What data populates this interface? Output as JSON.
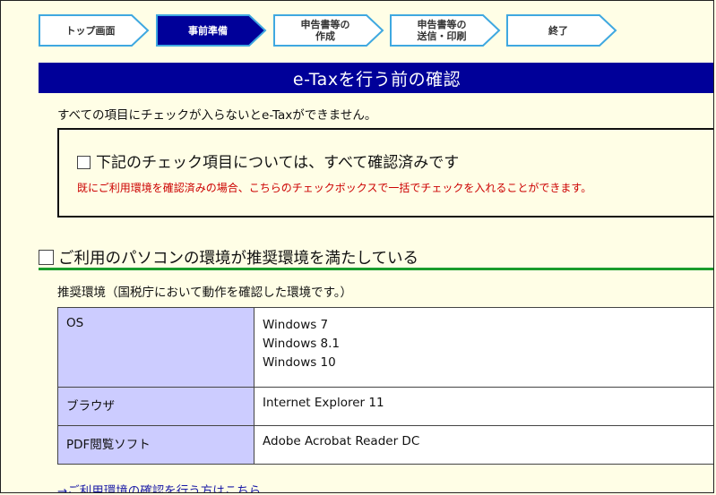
{
  "steps": [
    {
      "label": "トップ画面",
      "active": false
    },
    {
      "label": "事前準備",
      "active": true
    },
    {
      "label": "申告書等の\n作成",
      "active": false
    },
    {
      "label": "申告書等の\n送信・印刷",
      "active": false
    },
    {
      "label": "終了",
      "active": false
    }
  ],
  "title": "e-Taxを行う前の確認",
  "note": "すべての項目にチェックが入らないとe-Taxができません。",
  "confirm_all": {
    "label": "下記のチェック項目については、すべて確認済みです",
    "hint": "既にご利用環境を確認済みの場合、こちらのチェックボックスで一括でチェックを入れることができます。"
  },
  "section": {
    "label": "ご利用のパソコンの環境が推奨環境を満たしている",
    "recommended_note": "推奨環境（国税庁において動作を確認した環境です。）"
  },
  "env_table": {
    "os_label": "OS",
    "os_values": [
      "Windows 7",
      "Windows 8.1",
      "Windows 10"
    ],
    "browser_label": "ブラウザ",
    "browser_value": "Internet Explorer 11",
    "pdf_label": "PDF閲覧ソフト",
    "pdf_value": "Adobe Acrobat Reader DC"
  },
  "link_text": "→ご利用環境の確認を行う方はこちら",
  "colors": {
    "background": "#fffee6",
    "title_bar": "#000099",
    "step_active": "#000099",
    "step_border": "#3fa8e0",
    "hint_red": "#cc0000",
    "section_line": "#1a9c2c",
    "table_key": "#ccccff"
  }
}
